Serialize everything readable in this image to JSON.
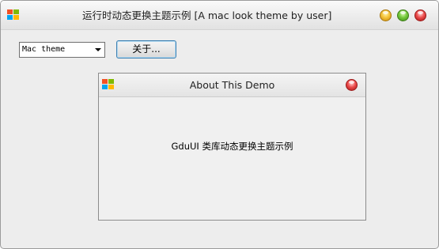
{
  "window": {
    "title": "运行时动态更换主题示例 [A mac look theme by user]",
    "icon": "windows-logo-icon",
    "controls": {
      "minimize": "minimize-icon",
      "maximize": "maximize-icon",
      "close": "close-icon"
    }
  },
  "toolbar": {
    "theme_select": {
      "value": "Mac theme"
    },
    "about_label": "关于..."
  },
  "dialog": {
    "title": "About This Demo",
    "icon": "windows-logo-icon",
    "message": "GduUI 类库动态更换主题示例",
    "close": "close-icon"
  },
  "colors": {
    "minimize": "#f5c43a",
    "maximize": "#75c93c",
    "close": "#ec4d4d",
    "button_focus_border": "#3c7fb1"
  }
}
